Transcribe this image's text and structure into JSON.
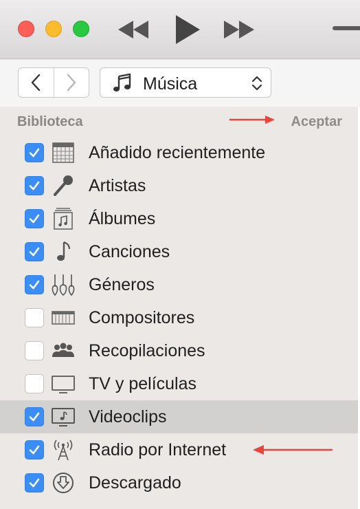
{
  "media_selector": {
    "value": "Música"
  },
  "library": {
    "section_title": "Biblioteca",
    "done_label": "Aceptar",
    "items": [
      {
        "label": "Añadido recientemente",
        "checked": true,
        "icon": "calendar-grid-icon"
      },
      {
        "label": "Artistas",
        "checked": true,
        "icon": "microphone-icon"
      },
      {
        "label": "Álbumes",
        "checked": true,
        "icon": "album-icon"
      },
      {
        "label": "Canciones",
        "checked": true,
        "icon": "music-note-icon"
      },
      {
        "label": "Géneros",
        "checked": true,
        "icon": "guitars-icon"
      },
      {
        "label": "Compositores",
        "checked": false,
        "icon": "piano-keys-icon"
      },
      {
        "label": "Recopilaciones",
        "checked": false,
        "icon": "people-group-icon"
      },
      {
        "label": "TV y películas",
        "checked": false,
        "icon": "tv-icon"
      },
      {
        "label": "Videoclips",
        "checked": true,
        "icon": "music-video-icon",
        "highlighted": true
      },
      {
        "label": "Radio por Internet",
        "checked": true,
        "icon": "radio-tower-icon"
      },
      {
        "label": "Descargado",
        "checked": true,
        "icon": "download-circle-icon"
      }
    ]
  },
  "colors": {
    "checkbox_checked": "#3b8ef5",
    "annotation_arrow": "#e8453c",
    "highlight_row": "#d3d1d0"
  }
}
